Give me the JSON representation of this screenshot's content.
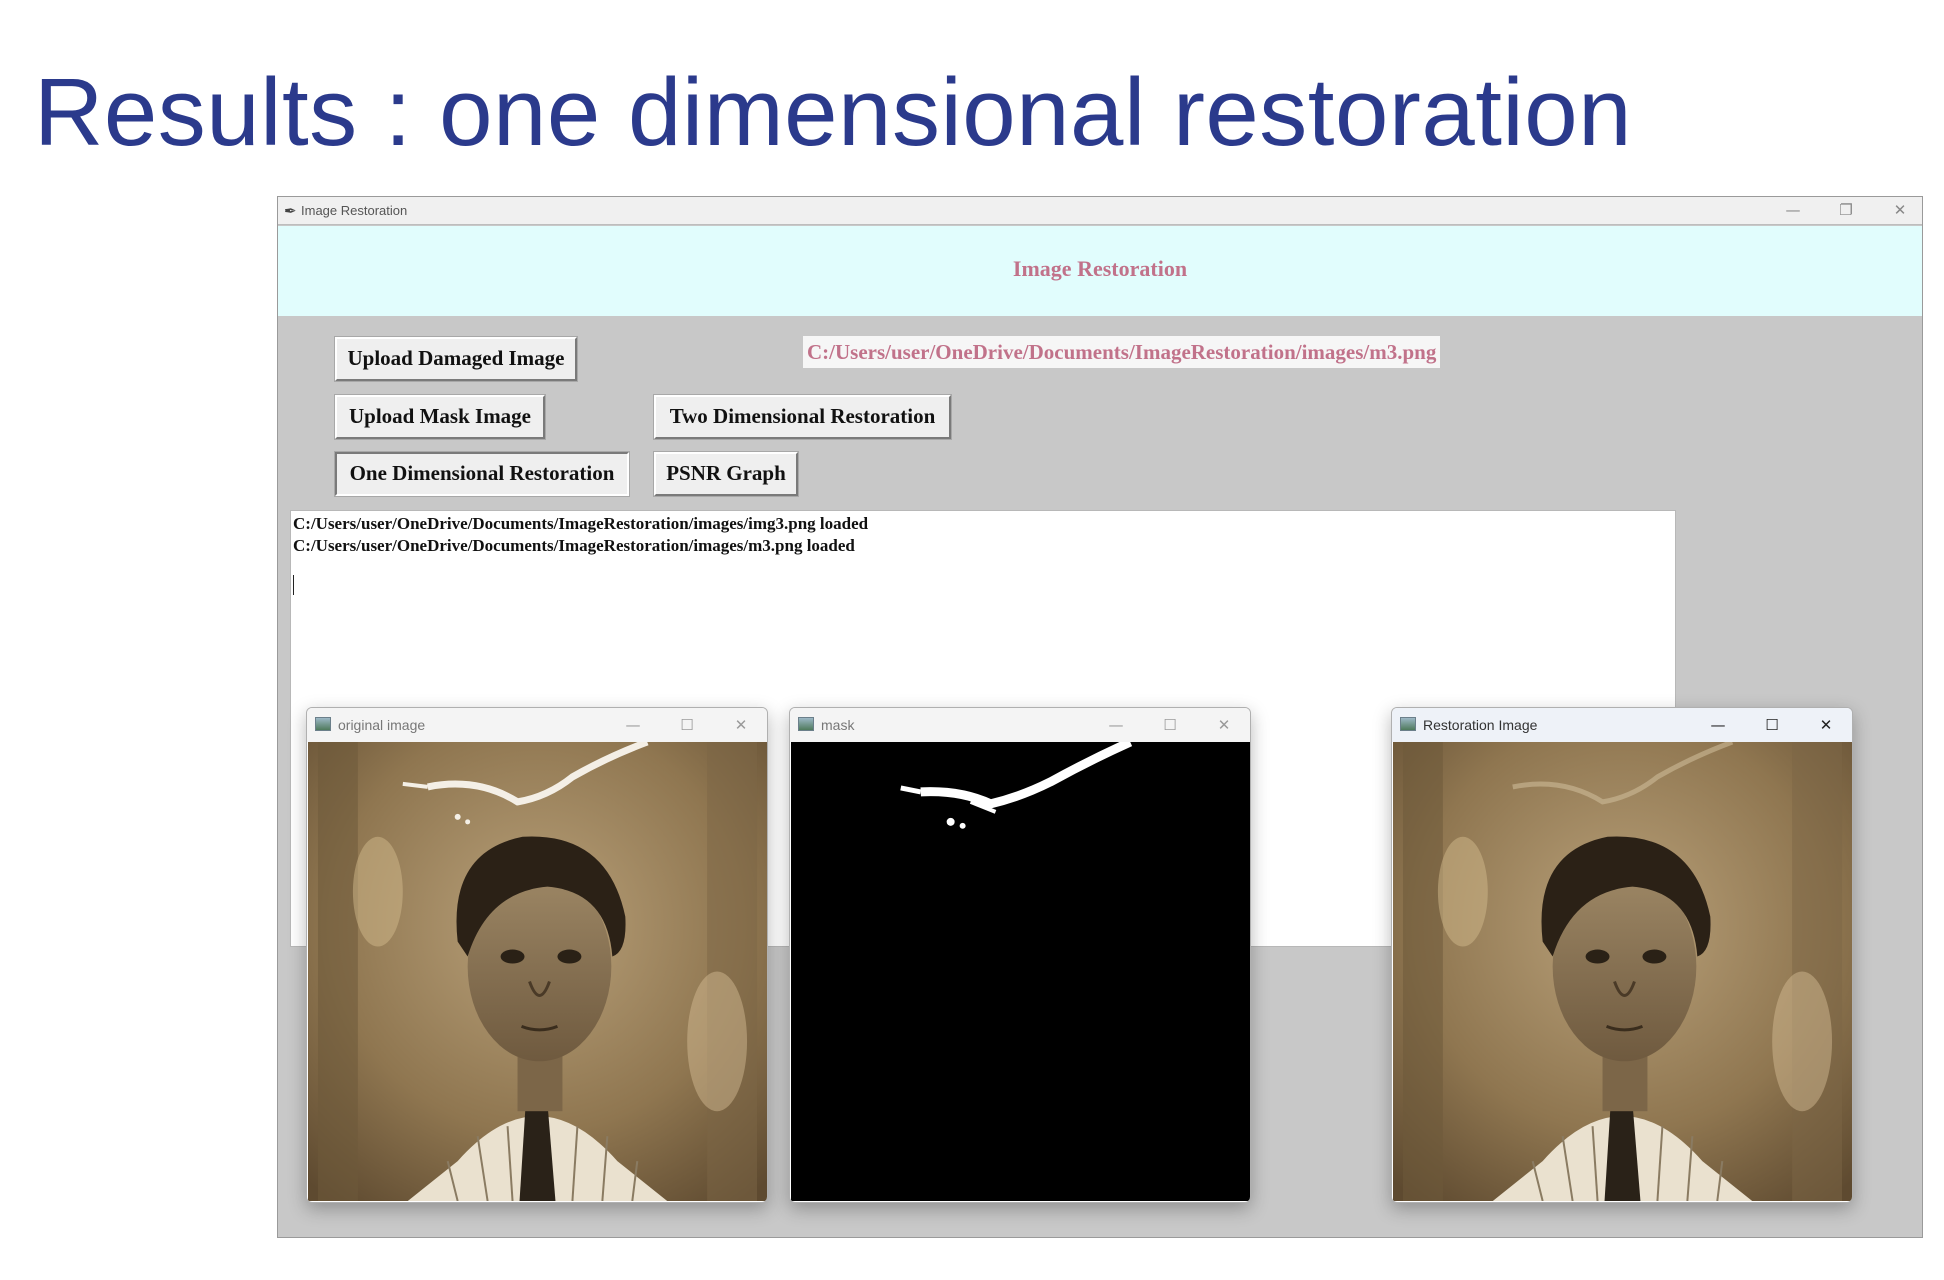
{
  "slide": {
    "title": "Results : one dimensional restoration"
  },
  "app": {
    "window_title": "Image Restoration",
    "header_title": "Image Restoration",
    "controls": {
      "minimize": "—",
      "restore": "❐",
      "close": "✕"
    },
    "buttons": {
      "upload_damaged": "Upload Damaged Image",
      "upload_mask": "Upload Mask Image",
      "two_dim": "Two Dimensional Restoration",
      "one_dim": "One Dimensional Restoration",
      "psnr": "PSNR Graph"
    },
    "path_label": "C:/Users/user/OneDrive/Documents/ImageRestoration/images/m3.png",
    "log_lines": [
      "C:/Users/user/OneDrive/Documents/ImageRestoration/images/img3.png loaded",
      "C:/Users/user/OneDrive/Documents/ImageRestoration/images/m3.png loaded"
    ]
  },
  "windows": {
    "original": {
      "title": "original image"
    },
    "mask": {
      "title": "mask"
    },
    "restoration": {
      "title": "Restoration Image"
    },
    "controls": {
      "minimize": "—",
      "maximize": "☐",
      "close": "✕"
    }
  },
  "colors": {
    "title_blue": "#2b3a8c",
    "header_bg": "#e1fdfd",
    "accent_pink": "#c1728a",
    "app_bg": "#c8c8c8"
  }
}
